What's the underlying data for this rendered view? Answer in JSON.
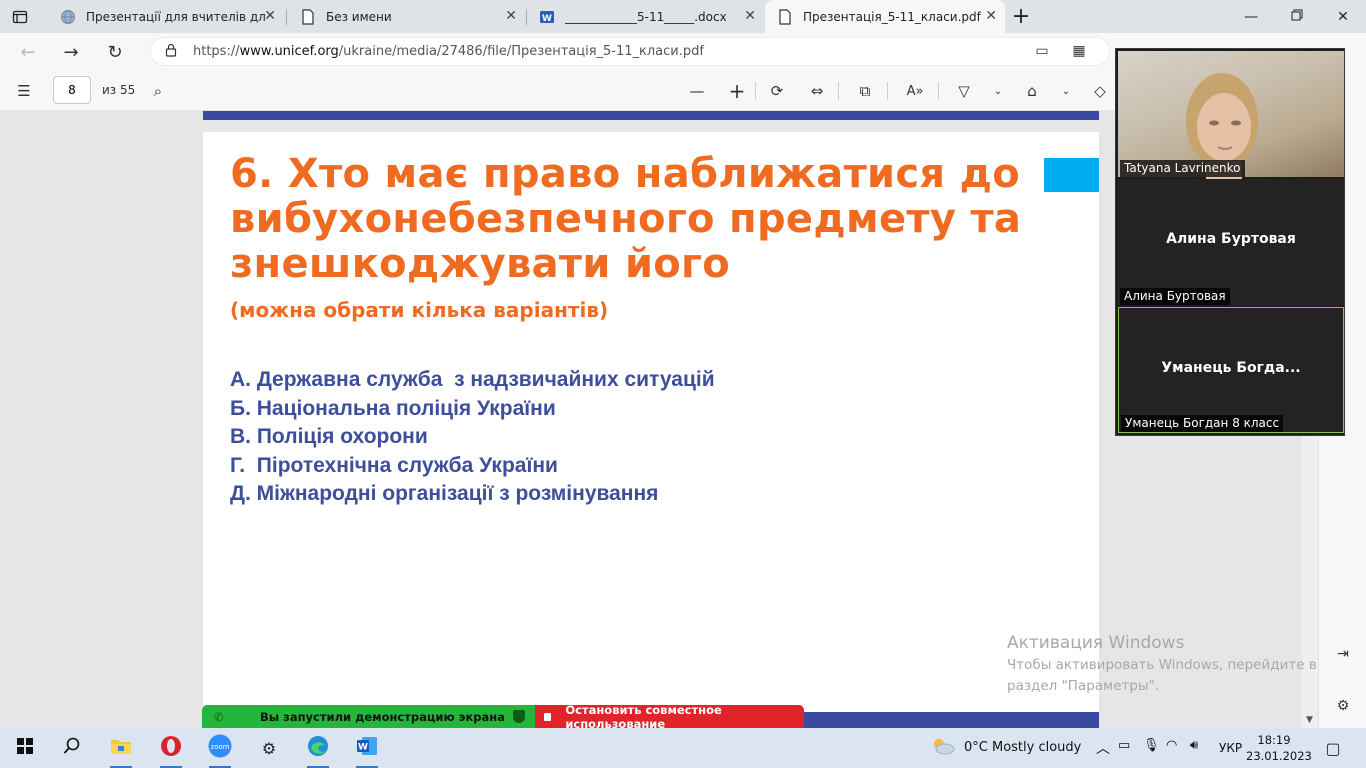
{
  "tabs": [
    {
      "title": "Презентації для вчителів для пр",
      "icon": "globe-icon"
    },
    {
      "title": "Без имени",
      "icon": "page-icon"
    },
    {
      "title": "____________5-11_____.docx",
      "icon": "word-icon"
    },
    {
      "title": "Презентація_5-11_класи.pdf",
      "icon": "page-icon",
      "active": true
    }
  ],
  "address": {
    "host_prefix": "https://",
    "host": "www.unicef.org",
    "path": "/ukraine/media/27486/file/Презентація_5-11_класи.pdf"
  },
  "pdf": {
    "page_current": "8",
    "page_total": "из 55"
  },
  "slide": {
    "title": "6. Хто має право наближатися до вибухонебезпечного предмету та знешкоджувати його",
    "subtitle": "(можна обрати кілька варіантів)",
    "options": [
      "А. Державна служба  з надзвичайних ситуацій",
      "Б. Національна поліція України",
      "В. Поліція охорони",
      "Г.  Піротехнічна служба України",
      "Д. Міжнародні організації з розмінування"
    ]
  },
  "video": {
    "tiles": [
      {
        "center": "",
        "label": "Tatyana Lavrinenko"
      },
      {
        "center": "Алина Буртовая",
        "label": "Алина Буртовая"
      },
      {
        "center": "Уманець  Богда...",
        "label": "Уманець Богдан 8 класс"
      }
    ]
  },
  "activation": {
    "heading": "Активация Windows",
    "line1": "Чтобы активировать Windows, перейдите в",
    "line2": "раздел \"Параметры\"."
  },
  "sharing": {
    "started": "Вы запустили демонстрацию экрана",
    "stop": "Остановить совместное использование"
  },
  "taskbar": {
    "weather": "0°C  Mostly cloudy",
    "lang": "УКР",
    "time": "18:19",
    "date": "23.01.2023"
  }
}
